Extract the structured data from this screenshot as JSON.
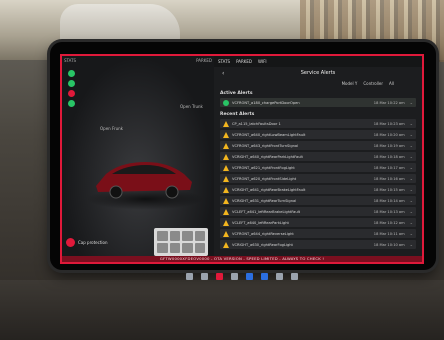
{
  "screen": {
    "title": "Service Alerts",
    "back_icon": "‹",
    "topbar": [
      "STATS",
      "PARKED",
      "WIFI"
    ],
    "filters": [
      "Model Y",
      "Controller",
      "All"
    ],
    "active_label": "Active Alerts",
    "recent_label": "Recent Alerts",
    "left_panel": {
      "frunk": "Open\nFrunk",
      "trunk": "Open\nTrunk",
      "bottom_text": "Cap protection"
    },
    "message": "GFTW0000XFDEOV0000 - OTA VERSION - SPEED LIMITED - ALWAYS TO CHECK !"
  },
  "alerts": {
    "active": [
      {
        "name": "VCFRONT_a180_chargePortDoorOpen",
        "time": "18 Mar 10:22 am",
        "status": "ok"
      }
    ],
    "recent": [
      {
        "name": "CP_a115_latchFaultsDoor 1",
        "time": "18 Mar 10:23 am"
      },
      {
        "name": "VCFRONT_a640_rightLowBeamLightFault",
        "time": "18 Mar 10:20 am"
      },
      {
        "name": "VCFRONT_a643_rightFrontTurnSignal",
        "time": "18 Mar 10:19 am"
      },
      {
        "name": "VCRIGHT_a640_rightRearParkLightFault",
        "time": "18 Mar 10:18 am"
      },
      {
        "name": "VCFRONT_a621_rightFrontFogLight",
        "time": "18 Mar 10:17 am"
      },
      {
        "name": "VCFRONT_a620_rightFrontSideLight",
        "time": "18 Mar 10:16 am"
      },
      {
        "name": "VCRIGHT_a641_rightRearBrakeLightFault",
        "time": "18 Mar 10:15 am"
      },
      {
        "name": "VCRIGHT_a631_rightRearTurnSignal",
        "time": "18 Mar 10:14 am"
      },
      {
        "name": "VCLEFT_a641_leftRearBrakeLightFault",
        "time": "18 Mar 10:13 am"
      },
      {
        "name": "VCLEFT_a640_leftRearParkLight",
        "time": "18 Mar 10:12 am"
      },
      {
        "name": "VCFRONT_a644_rightReverseLight",
        "time": "18 Mar 10:11 am"
      },
      {
        "name": "VCRIGHT_a630_rightRearFogLight",
        "time": "18 Mar 10:10 am"
      }
    ]
  },
  "colors": {
    "frame_red": "#e0193a",
    "warn_yellow": "#f2b51e",
    "ok_green": "#29c466"
  }
}
